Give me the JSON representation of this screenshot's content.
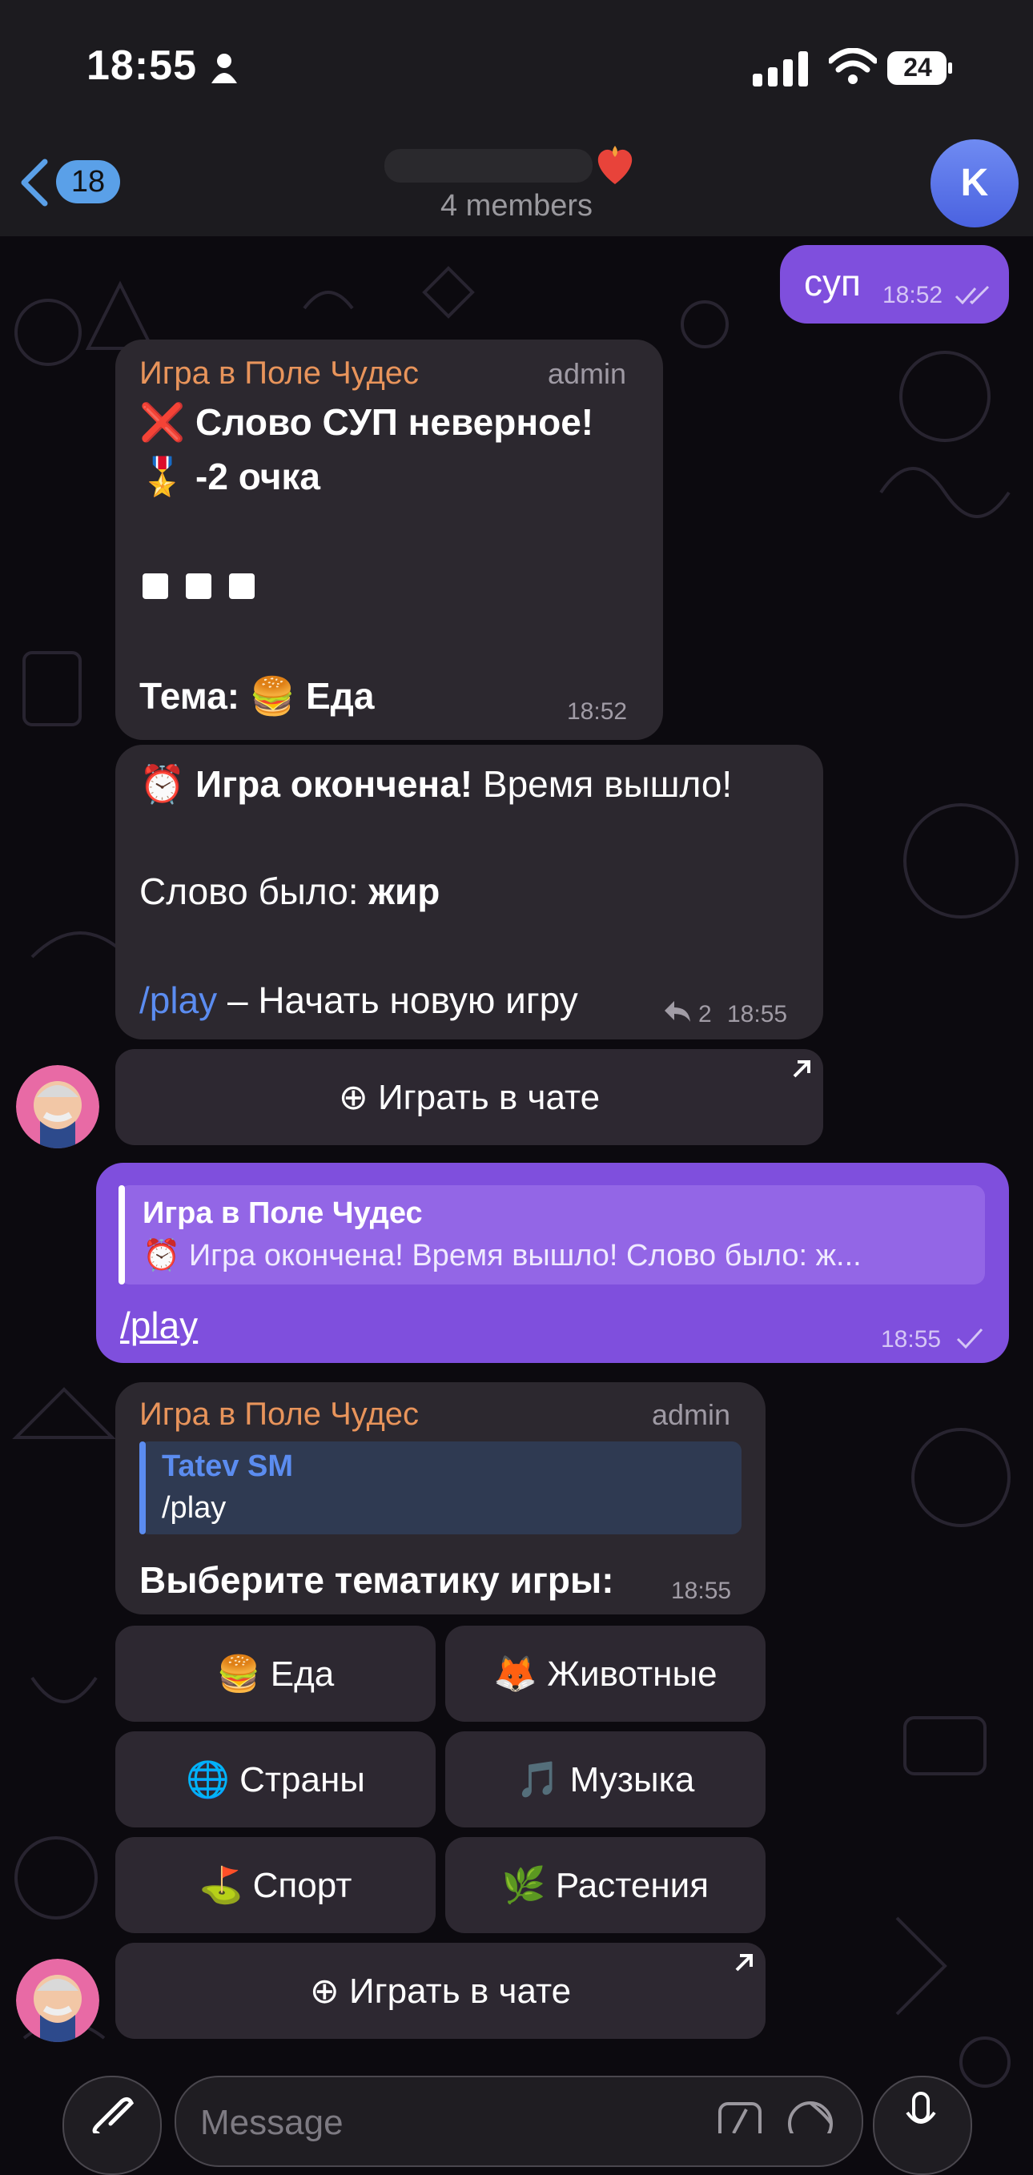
{
  "status_bar": {
    "time": "18:55",
    "battery": "24"
  },
  "header": {
    "back_count": "18",
    "members": "4 members",
    "avatar_letter": "K"
  },
  "messages": {
    "m1": {
      "text": "суп",
      "time": "18:52"
    },
    "m2": {
      "sender": "Игра в Поле Чудес",
      "role": "admin",
      "line1": "❌ Слово СУП неверное!",
      "line2": "🎖️ -2 очка",
      "line4": "Тема: 🍔 Еда",
      "time": "18:52"
    },
    "m3": {
      "line1_bold": "⏰ Игра окончена!",
      "line1_rest": " Время вышло!",
      "line2_label": "Слово было: ",
      "line2_bold": "жир",
      "cmd": "/play",
      "cmd_rest": " – Начать новую игру",
      "replies": "2",
      "time": "18:55",
      "button": "⊕ Играть в чате"
    },
    "m4": {
      "quote_sender": "Игра в Поле Чудес",
      "quote_text": "⏰ Игра окончена! Время вышло! Слово было: ж...",
      "text": "/play",
      "time": "18:55"
    },
    "m5": {
      "sender": "Игра в Поле Чудес",
      "role": "admin",
      "quote_sender": "Tatev SM",
      "quote_text": "/play",
      "text": "Выберите тематику игры:",
      "time": "18:55",
      "buttons": [
        "🍔 Еда",
        "🦊 Животные",
        "🌐 Страны",
        "🎵 Музыка",
        "⛳ Спорт",
        "🌿 Растения"
      ],
      "play_button": "⊕ Играть в чате"
    }
  },
  "composer": {
    "placeholder": "Message"
  },
  "colors": {
    "outgoing": "#7f4fdd",
    "incoming": "#2c282f",
    "sender": "#e8945b",
    "link": "#5b8cf0"
  }
}
